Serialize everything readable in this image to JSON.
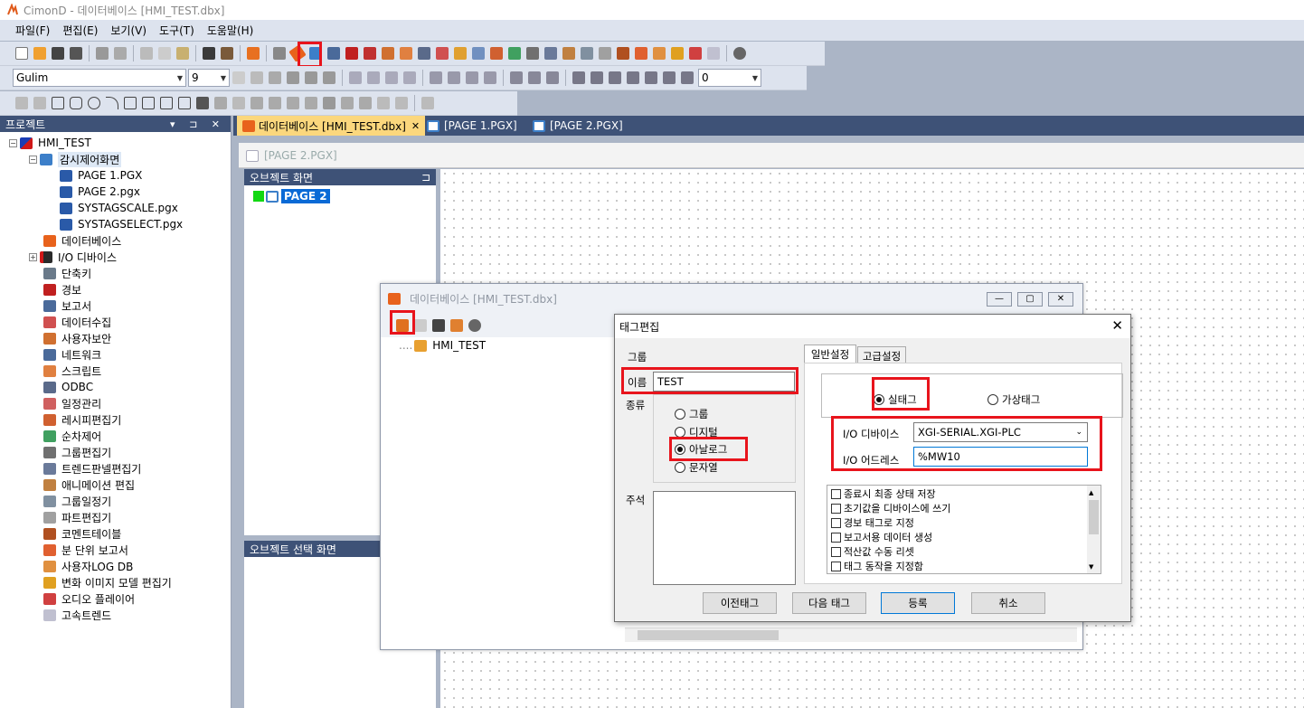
{
  "app": {
    "title": "CimonD - 데이터베이스 [HMI_TEST.dbx]"
  },
  "menu": [
    "파일(F)",
    "편집(E)",
    "보기(V)",
    "도구(T)",
    "도움말(H)"
  ],
  "format": {
    "font": "Gulim",
    "size": "9",
    "line_width": "0"
  },
  "project": {
    "title": "프로젝트",
    "controls": "▾ ⊐ ✕",
    "root": "HMI_TEST",
    "screen_group": "감시제어화면",
    "pages": [
      "PAGE 1.PGX",
      "PAGE 2.pgx",
      "SYSTAGSCALE.pgx",
      "SYSTAGSELECT.pgx"
    ],
    "items": [
      "데이터베이스",
      "I/O 디바이스",
      "단축키",
      "경보",
      "보고서",
      "데이터수집",
      "사용자보안",
      "네트워크",
      "스크립트",
      "ODBC",
      "일정관리",
      "레시피편집기",
      "순차제어",
      "그룹편집기",
      "트렌드판넬편집기",
      "애니메이션 편집",
      "그룹일정기",
      "파트편집기",
      "코멘트테이블",
      "분 단위 보고서",
      "사용자LOG DB",
      "변화 이미지 모델 편집기",
      "오디오 플레이어",
      "고속트렌드"
    ]
  },
  "doc_tabs": [
    {
      "label": "데이터베이스 [HMI_TEST.dbx]",
      "close": "✕"
    },
    {
      "label": "[PAGE 1.PGX]"
    },
    {
      "label": "[PAGE 2.PGX]"
    }
  ],
  "page_bar": {
    "label": "[PAGE 2.PGX]"
  },
  "object_panel": {
    "title": "오브젝트 화면",
    "pin": "⊐",
    "item": "PAGE 2"
  },
  "object_select_panel": {
    "title": "오브젝트 선택 화면"
  },
  "db_window": {
    "title": "데이터베이스 [HMI_TEST.dbx]",
    "tree_root": "HMI_TEST",
    "minimize": "—",
    "restore": "▢",
    "close": "✕"
  },
  "tag_dialog": {
    "title": "태그편집",
    "close": "✕",
    "group_label": "그룹",
    "name_label": "이름",
    "name_value": "TEST",
    "type_label": "종류",
    "types": [
      "그룹",
      "디지털",
      "아날로그",
      "문자열"
    ],
    "selected_type": "아날로그",
    "comment_label": "주석",
    "tabs": [
      "일반설정",
      "고급설정"
    ],
    "real_tag": "실태그",
    "virtual_tag": "가상태그",
    "io_device_label": "I/O 디바이스",
    "io_device_value": "XGI-SERIAL.XGI-PLC",
    "io_address_label": "I/O 어드레스",
    "io_address_value": "%MW10",
    "options": [
      "종료시 최종 상태 저장",
      "초기값을 디바이스에 쓰기",
      "경보 태그로 지정",
      "보고서용 데이터 생성",
      "적산값 수동 리셋",
      "태그 동작을 지정함"
    ],
    "buttons": {
      "prev": "이전태그",
      "next": "다음 태그",
      "register": "등록",
      "cancel": "취소"
    }
  },
  "colors": {
    "accent_red": "#e8141c",
    "panel_header": "#3e5277",
    "active_tab": "#fbd77d"
  }
}
